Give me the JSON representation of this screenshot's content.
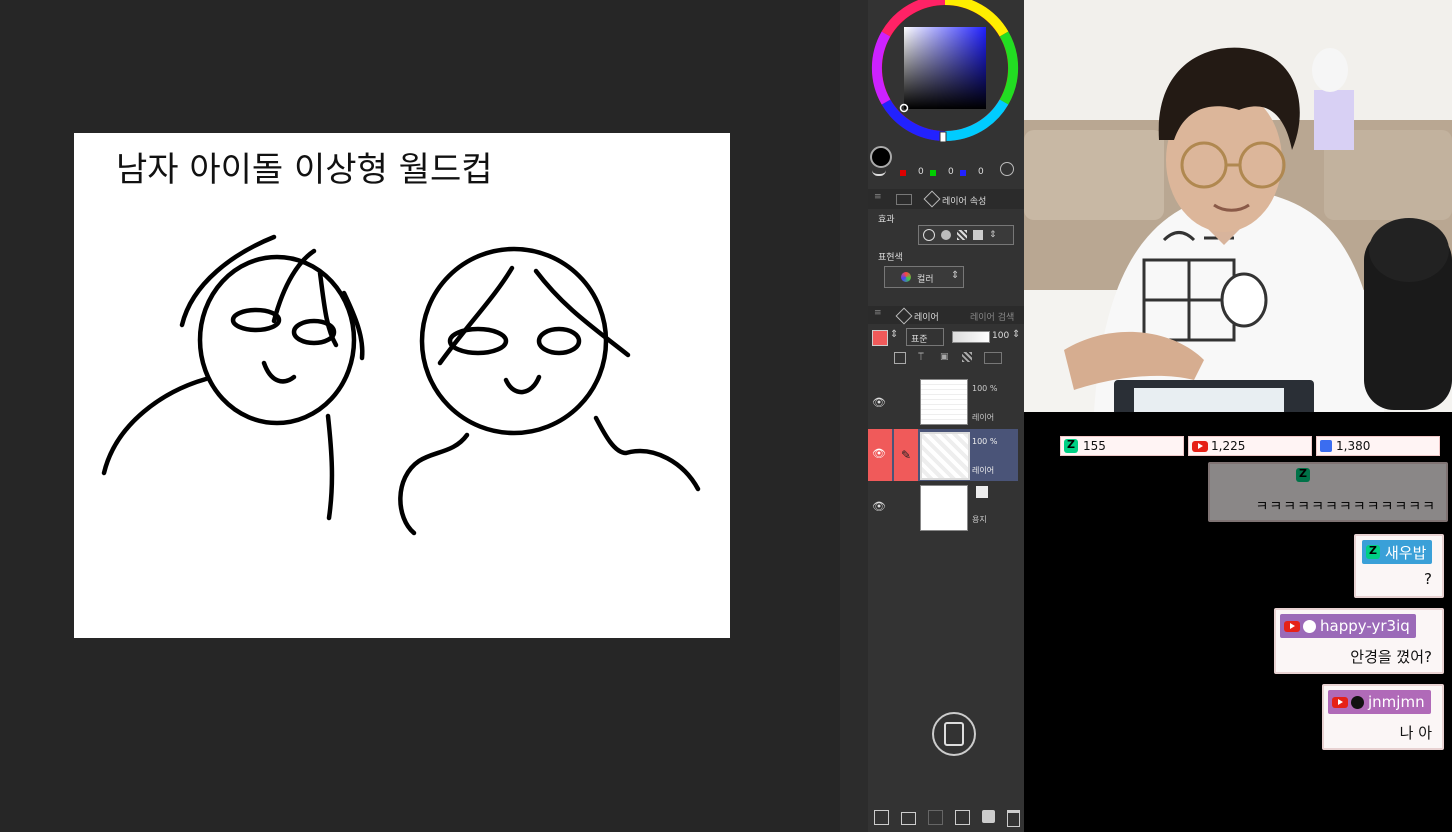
{
  "canvas": {
    "title_text": "남자 아이돌 이상형 월드컵"
  },
  "color_panel": {
    "rgb_r": "0",
    "rgb_g": "0",
    "rgb_b": "0"
  },
  "layer_props": {
    "tab_label": "레이어 속성",
    "effect_label": "효과",
    "express_label": "표현색",
    "color_select": "컬러"
  },
  "layer_panel": {
    "tab_layer": "레이어",
    "tab_search": "레이어 검색",
    "blend_mode": "표준",
    "opacity": "100",
    "layers": [
      {
        "opacity": "100 %",
        "name": "레이어"
      },
      {
        "opacity": "100 %",
        "name": "레이어"
      },
      {
        "opacity": "",
        "name": "용지"
      }
    ]
  },
  "stream": {
    "counters": [
      {
        "platform": "chzzk",
        "value": "155"
      },
      {
        "platform": "youtube",
        "value": "1,225"
      },
      {
        "platform": "soop",
        "value": "1,380"
      }
    ],
    "chat": [
      {
        "platform": "chzzk",
        "user": "",
        "text": "ㅋㅋㅋㅋㅋㅋㅋㅋㅋㅋㅋㅋㅋ"
      },
      {
        "platform": "chzzk",
        "user": "새우밥",
        "text": "?"
      },
      {
        "platform": "youtube",
        "user": "happy-yr3iq",
        "text": "안경을 꼈어?"
      },
      {
        "platform": "youtube",
        "user": "jnmjmn",
        "text": "나 아"
      }
    ]
  },
  "colors": {
    "bg": "#262626",
    "panel": "#333333",
    "accent_red": "#f05a5a",
    "selected_layer": "#4a5478"
  }
}
